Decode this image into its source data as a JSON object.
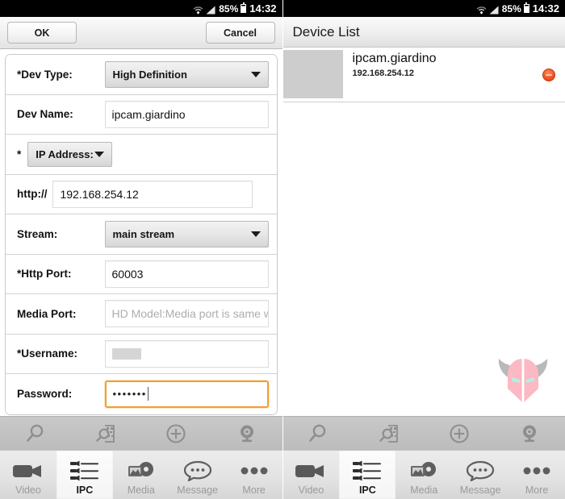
{
  "status_bar": {
    "battery": "85%",
    "time": "14:32",
    "wifi_icon": "wifi-icon",
    "signal_icon": "signal-icon",
    "battery_icon": "battery-icon"
  },
  "left_panel": {
    "action_bar": {
      "ok_label": "OK",
      "cancel_label": "Cancel"
    },
    "form": {
      "rows": [
        {
          "label": "*Dev Type:",
          "type": "select",
          "value": "High Definition",
          "name": "dev-type"
        },
        {
          "label": "Dev Name:",
          "type": "input",
          "value": "ipcam.giardino",
          "name": "dev-name"
        },
        {
          "label": "*",
          "type": "select-small",
          "value": "IP Address:",
          "name": "address-mode"
        },
        {
          "label": "http://",
          "type": "input",
          "value": "192.168.254.12",
          "name": "host"
        },
        {
          "label": "Stream:",
          "type": "select",
          "value": "main stream",
          "name": "stream"
        },
        {
          "label": "*Http Port:",
          "type": "input",
          "value": "60003",
          "name": "http-port"
        },
        {
          "label": "Media Port:",
          "type": "input",
          "value": "",
          "placeholder": "HD Model:Media port is same w",
          "name": "media-port"
        },
        {
          "label": "*Username:",
          "type": "input-redacted",
          "value": "",
          "name": "username"
        },
        {
          "label": "Password:",
          "type": "input-password",
          "value": "•••••••",
          "name": "password",
          "focused": true
        }
      ]
    }
  },
  "right_panel": {
    "title": "Device List",
    "devices": [
      {
        "name": "ipcam.giardino",
        "ip": "192.168.254.12",
        "status": "offline",
        "status_color": "#f2562a"
      }
    ],
    "watermark": "viking-helmet-logo"
  },
  "toolbar": {
    "buttons": [
      {
        "name": "search-icon",
        "label": "Search"
      },
      {
        "name": "qr-scan-icon",
        "label": "Scan QR"
      },
      {
        "name": "add-icon",
        "label": "Add"
      },
      {
        "name": "camera-icon",
        "label": "Camera"
      }
    ]
  },
  "tabs": [
    {
      "label": "Video",
      "icon": "video-camera-icon",
      "active": false
    },
    {
      "label": "IPC",
      "icon": "ipc-list-icon",
      "active": true
    },
    {
      "label": "Media",
      "icon": "media-icon",
      "active": false
    },
    {
      "label": "Message",
      "icon": "message-bubble-icon",
      "active": false
    },
    {
      "label": "More",
      "icon": "more-dots-icon",
      "active": false
    }
  ],
  "colors": {
    "focus_orange": "#f0a030",
    "status_red": "#f2562a",
    "status_bar_bg": "#000000"
  }
}
